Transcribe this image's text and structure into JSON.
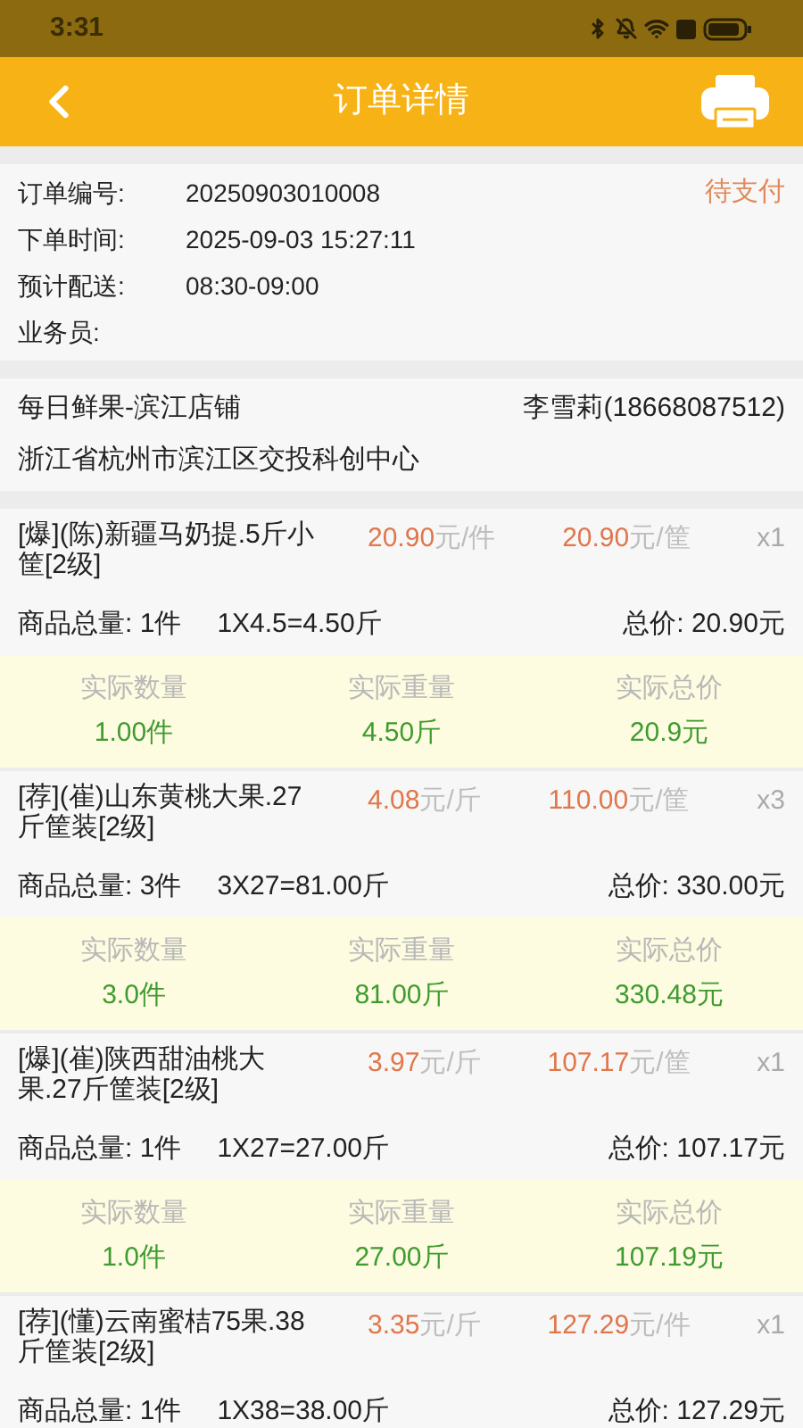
{
  "status_bar": {
    "time": "3:31"
  },
  "header": {
    "title": "订单详情"
  },
  "order": {
    "fields": [
      {
        "label": "订单编号:",
        "value": "20250903010008"
      },
      {
        "label": "下单时间:",
        "value": "2025-09-03 15:27:11"
      },
      {
        "label": "预计配送:",
        "value": "08:30-09:00"
      },
      {
        "label": "业务员:"
      }
    ],
    "status": "待支付"
  },
  "shop": {
    "name": "每日鲜果-滨江店铺",
    "contact": "李雪莉(18668087512)",
    "address": "浙江省杭州市滨江区交投科创中心"
  },
  "items": [
    {
      "name": "[爆](陈)新疆马奶提.5斤小筐[2级]",
      "unit_price": {
        "amount": "20.90",
        "unit": "元/件"
      },
      "pack_price": {
        "amount": "20.90",
        "unit": "元/筐"
      },
      "count": "x1",
      "qty_label": "商品总量:",
      "qty": "1件",
      "formula": "1X4.5=4.50斤",
      "total_label": "总价:",
      "total": "20.90元",
      "actual": [
        {
          "label": "实际数量",
          "value": "1.00件"
        },
        {
          "label": "实际重量",
          "value": "4.50斤"
        },
        {
          "label": "实际总价",
          "value": "20.9元"
        }
      ]
    },
    {
      "name": "[荐](崔)山东黄桃大果.27斤筐装[2级]",
      "unit_price": {
        "amount": "4.08",
        "unit": "元/斤"
      },
      "pack_price": {
        "amount": "110.00",
        "unit": "元/筐"
      },
      "count": "x3",
      "qty_label": "商品总量:",
      "qty": "3件",
      "formula": "3X27=81.00斤",
      "total_label": "总价:",
      "total": "330.00元",
      "actual": [
        {
          "label": "实际数量",
          "value": "3.0件"
        },
        {
          "label": "实际重量",
          "value": "81.00斤"
        },
        {
          "label": "实际总价",
          "value": "330.48元"
        }
      ]
    },
    {
      "name": "[爆](崔)陕西甜油桃大果.27斤筐装[2级]",
      "unit_price": {
        "amount": "3.97",
        "unit": "元/斤"
      },
      "pack_price": {
        "amount": "107.17",
        "unit": "元/筐"
      },
      "count": "x1",
      "qty_label": "商品总量:",
      "qty": "1件",
      "formula": "1X27=27.00斤",
      "total_label": "总价:",
      "total": "107.17元",
      "actual": [
        {
          "label": "实际数量",
          "value": "1.0件"
        },
        {
          "label": "实际重量",
          "value": "27.00斤"
        },
        {
          "label": "实际总价",
          "value": "107.19元"
        }
      ]
    },
    {
      "name": "[荐](懂)云南蜜桔75果.38斤筐装[2级]",
      "unit_price": {
        "amount": "3.35",
        "unit": "元/斤"
      },
      "pack_price": {
        "amount": "127.29",
        "unit": "元/件"
      },
      "count": "x1",
      "qty_label": "商品总量:",
      "qty": "1件",
      "formula": "1X38=38.00斤",
      "total_label": "总价:",
      "total": "127.29元"
    }
  ]
}
